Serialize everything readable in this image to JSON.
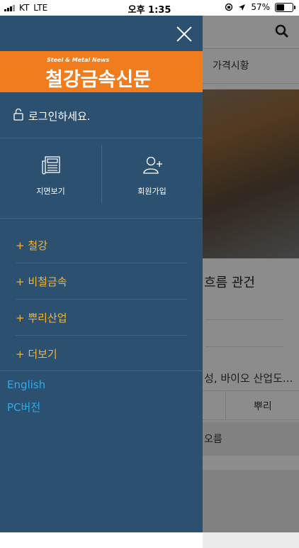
{
  "status_bar": {
    "carrier": "KT",
    "network": "LTE",
    "time": "오후 1:35",
    "battery": "57%",
    "battery_level": 0.57
  },
  "background": {
    "nav_item": "가격시황",
    "headline_fragment": "흐름 관건",
    "subheadline_fragment": "성, 바이오 산업도...",
    "pill_label": "뿌리",
    "trend_fragment": "오름"
  },
  "drawer": {
    "logo_sub": "Steel & Metal News",
    "logo_main": "철강금속신문",
    "login_text": "로그인하세요.",
    "quick_buttons": [
      {
        "label": "지면보기",
        "icon": "newspaper-icon"
      },
      {
        "label": "회원가입",
        "icon": "add-user-icon"
      }
    ],
    "menu": [
      {
        "label": "+ 철강"
      },
      {
        "label": "+ 비철금속"
      },
      {
        "label": "+ 뿌리산업"
      },
      {
        "label": "+ 더보기"
      }
    ],
    "english_link": "English",
    "pc_link": "PC버전"
  },
  "colors": {
    "drawer_bg": "#2c5070",
    "logo_bg": "#f07c1e",
    "menu_text": "#f3b43a",
    "link_text": "#36a8e8"
  }
}
